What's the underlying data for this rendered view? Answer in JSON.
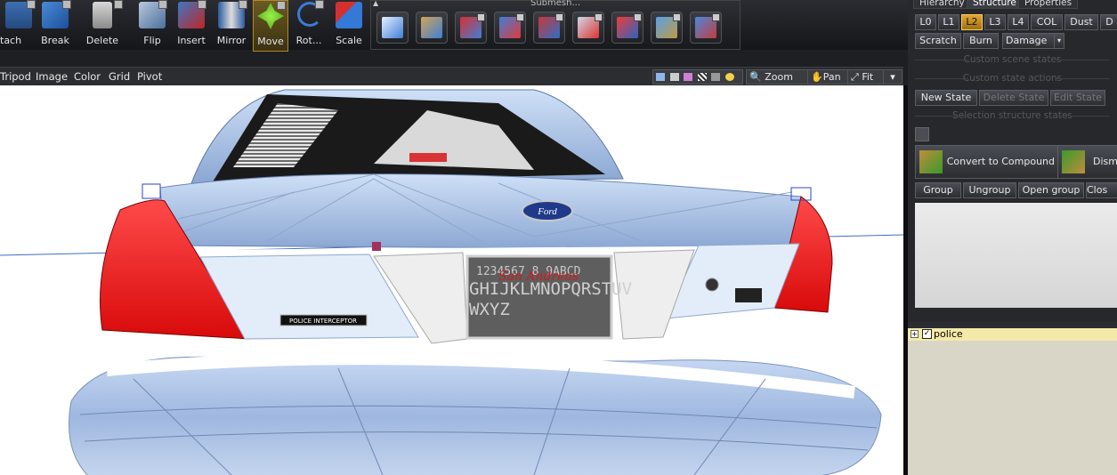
{
  "toolbar": {
    "buttons": [
      {
        "label": "tach",
        "icon": "attach-icon"
      },
      {
        "label": "Break",
        "icon": "break-icon"
      },
      {
        "label": "Delete",
        "icon": "trash-icon"
      },
      {
        "label": "Flip",
        "icon": "flip-icon"
      },
      {
        "label": "Insert",
        "icon": "insert-icon"
      },
      {
        "label": "Mirror",
        "icon": "mirror-icon"
      },
      {
        "label": "Move",
        "icon": "move-arrows-icon",
        "active": true
      },
      {
        "label": "Rot...",
        "icon": "rotate-icon"
      },
      {
        "label": "Scale",
        "icon": "scale-icon"
      }
    ],
    "submesh_title": "Submesh...",
    "submesh_icons": [
      "cube-icon",
      "brush-icon",
      "import-icon",
      "cut-icon",
      "cube-split-icon",
      "knife-icon",
      "diamond-icon",
      "box-paint-icon",
      "grid-icon"
    ]
  },
  "menubar": {
    "items": [
      "Tripod",
      "Image",
      "Color",
      "Grid",
      "Pivot"
    ],
    "zoom_label": "Zoom",
    "pan_label": "Pan",
    "fit_label": "Fit"
  },
  "viewport": {
    "license_plate_text": "San Andreas",
    "plate_chars_top": "1234567 8 9ABCD",
    "plate_chars_mid": "GHIJKLMNOPQRSTUV",
    "plate_chars_bot": "WXYZ",
    "badge_text": "POLICE INTERCEPTOR",
    "brand_text": "Ford"
  },
  "right_panel": {
    "tabs": [
      "Hierarchy",
      "Structure",
      "Properties"
    ],
    "selected_tab": "Structure",
    "lod_buttons": [
      "L0",
      "L1",
      "L2",
      "L3",
      "L4",
      "COL",
      "Dust",
      "D"
    ],
    "selected_lod": "L2",
    "damage_buttons": [
      "Scratch",
      "Burn",
      "Damage"
    ],
    "custom_scene_states": "Custom scene states",
    "custom_state_actions": "Custom state actions",
    "state_buttons": [
      "New State",
      "Delete State",
      "Edit State"
    ],
    "selection_structure_states": "Selection structure states",
    "convert_label": "Convert to Compound",
    "dismount_label": "Dism",
    "group_buttons": [
      "Group",
      "Ungroup",
      "Open group",
      "Clos"
    ]
  },
  "tree": {
    "item_label": "police",
    "checked": true
  },
  "colors": {
    "accent": "#e0a633",
    "viewport_bg": "#ffffff",
    "taillight": "#ff2a2a"
  }
}
